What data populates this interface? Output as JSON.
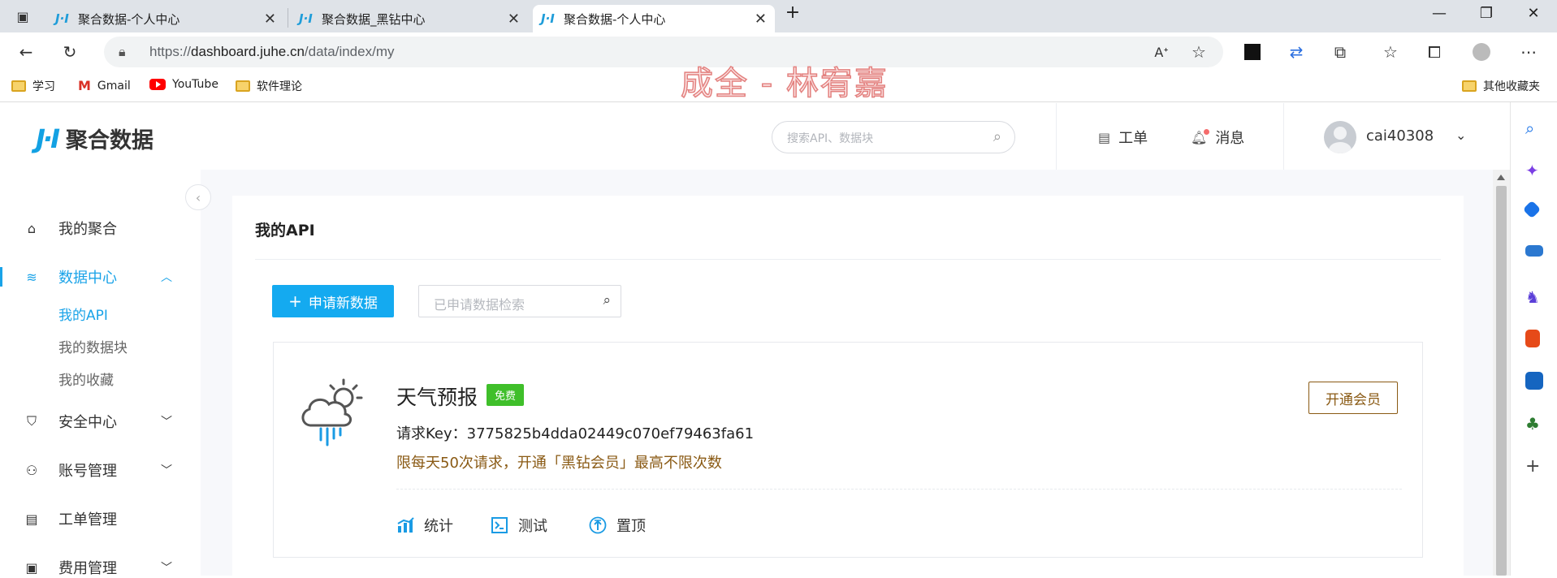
{
  "browser": {
    "tabs": [
      {
        "title": "聚合数据-个人中心"
      },
      {
        "title": "聚合数据_黑钻中心"
      },
      {
        "title": "聚合数据-个人中心"
      }
    ],
    "url_prefix": "https://",
    "url_host": "dashboard.juhe.cn",
    "url_path": "/data/index/my",
    "bookmarks": [
      "学习",
      "Gmail",
      "YouTube",
      "软件理论"
    ],
    "other_bookmarks": "其他收藏夹",
    "watermark": "成全 - 林宥嘉"
  },
  "header": {
    "logo_text": "聚合数据",
    "search_placeholder": "搜索API、数据块",
    "ticket_label": "工单",
    "message_label": "消息",
    "username": "cai40308"
  },
  "sidebar": {
    "items": [
      {
        "label": "我的聚合",
        "icon": "home-icon"
      },
      {
        "label": "数据中心",
        "icon": "layers-icon",
        "active": true
      },
      {
        "label": "安全中心",
        "icon": "shield-icon"
      },
      {
        "label": "账号管理",
        "icon": "user-icon"
      },
      {
        "label": "工单管理",
        "icon": "ticket-icon"
      },
      {
        "label": "费用管理",
        "icon": "wallet-icon"
      }
    ],
    "subitems": [
      {
        "label": "我的API",
        "active": true
      },
      {
        "label": "我的数据块"
      },
      {
        "label": "我的收藏"
      }
    ]
  },
  "content": {
    "title": "我的API",
    "apply_button": "申请新数据",
    "search_placeholder": "已申请数据检索",
    "card": {
      "name": "天气预报",
      "badge": "免费",
      "key_label": "请求Key：",
      "key_value": "3775825b4dda02449c070ef79463fa61",
      "limit_text": "限每天50次请求，开通「黑钻会员」最高不限次数",
      "vip_button": "开通会员",
      "actions": [
        "统计",
        "测试",
        "置顶"
      ]
    }
  },
  "colors": {
    "accent": "#1aa3e8",
    "primary_button": "#14aaf0",
    "free_badge": "#3fbf2a",
    "gold": "#8a5a14"
  }
}
